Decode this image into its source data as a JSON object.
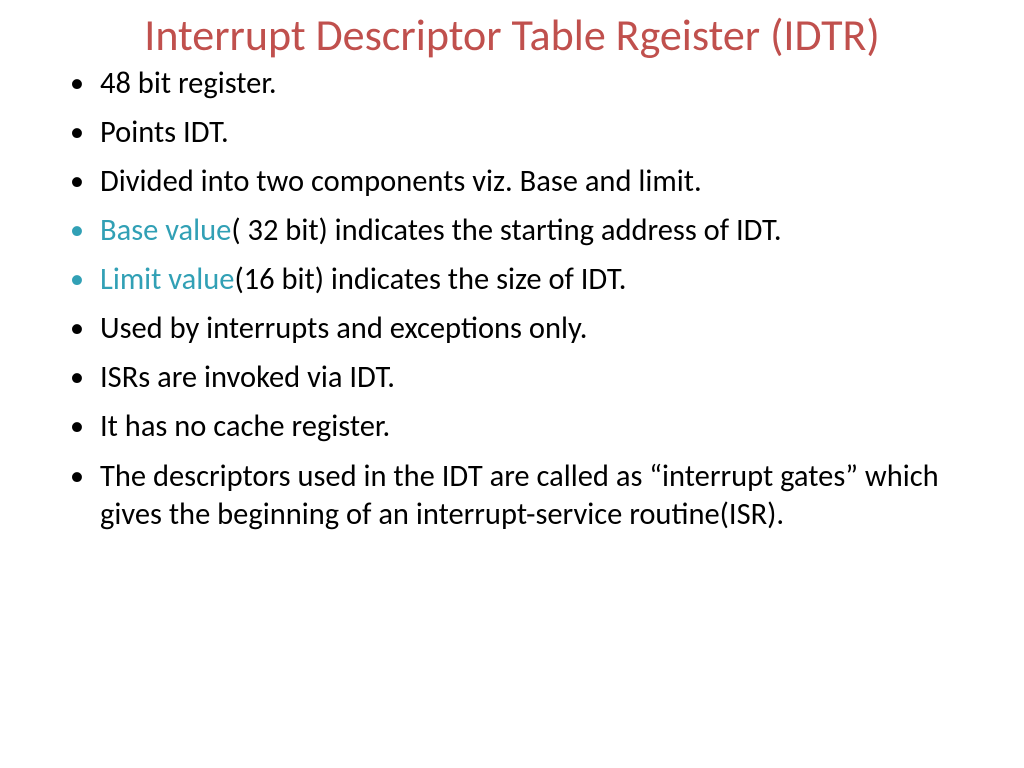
{
  "slide": {
    "title": "Interrupt Descriptor Table Rgeister (IDTR)",
    "bullets": [
      {
        "text": "48 bit register.",
        "accentPrefix": "",
        "accentBullet": false
      },
      {
        "text": "Points IDT.",
        "accentPrefix": "",
        "accentBullet": false
      },
      {
        "text": "Divided into two components viz. Base and limit.",
        "accentPrefix": "",
        "accentBullet": false
      },
      {
        "text": "( 32 bit) indicates the starting address of IDT.",
        "accentPrefix": "Base value",
        "accentBullet": true
      },
      {
        "text": "(16 bit) indicates the size of IDT.",
        "accentPrefix": "Limit value",
        "accentBullet": true
      },
      {
        "text": "Used by interrupts and exceptions only.",
        "accentPrefix": "",
        "accentBullet": false
      },
      {
        "text": "ISRs are invoked via IDT.",
        "accentPrefix": "",
        "accentBullet": false
      },
      {
        "text": "It has no cache register.",
        "accentPrefix": "",
        "accentBullet": false
      },
      {
        "text": "The descriptors used in the IDT are called as “interrupt gates” which gives the beginning of an interrupt-service routine(ISR).",
        "accentPrefix": "",
        "accentBullet": false
      }
    ]
  }
}
